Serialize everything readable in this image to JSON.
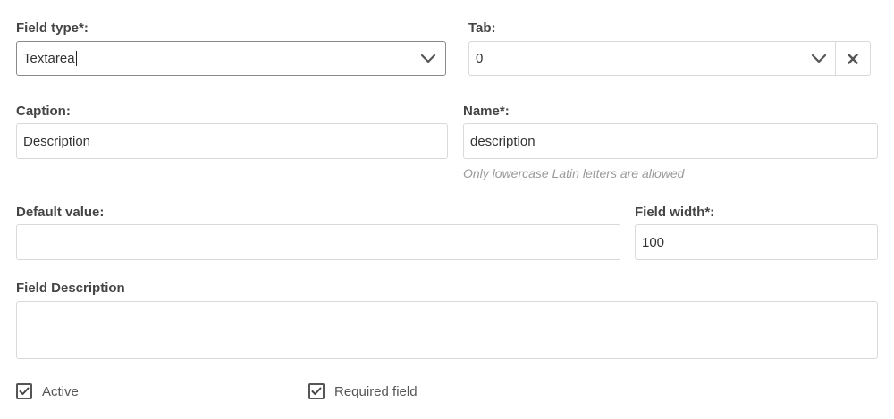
{
  "form": {
    "field_type": {
      "label": "Field type*:",
      "value": "Textarea",
      "icon": "chevron-down-icon"
    },
    "tab": {
      "label": "Tab:",
      "value": "0",
      "icon": "chevron-down-icon",
      "clear_icon": "close-icon"
    },
    "caption": {
      "label": "Caption:",
      "value": "Description"
    },
    "name": {
      "label": "Name*:",
      "value": "description",
      "hint": "Only lowercase Latin letters are allowed"
    },
    "default_value": {
      "label": "Default value:",
      "value": ""
    },
    "field_width": {
      "label": "Field width*:",
      "value": "100"
    },
    "field_description": {
      "label": "Field Description",
      "value": ""
    },
    "active": {
      "label": "Active",
      "checked": true
    },
    "required": {
      "label": "Required field",
      "checked": true
    }
  }
}
